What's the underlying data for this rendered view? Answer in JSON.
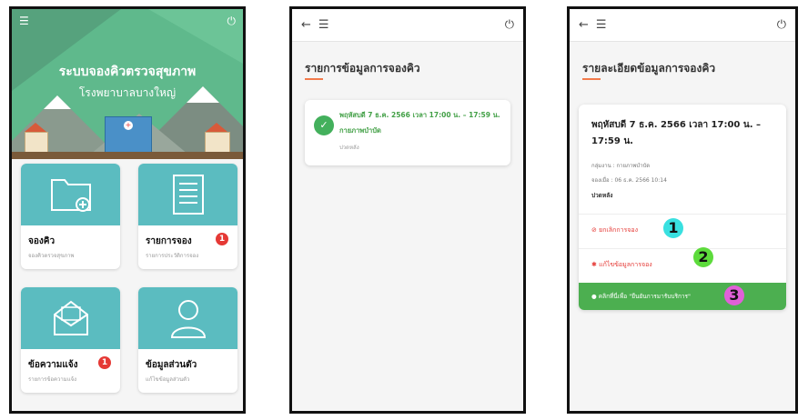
{
  "screen1": {
    "title": "ระบบจองคิวตรวจสุขภาพ",
    "subtitle": "โรงพยาบาลบางใหญ่",
    "tiles": [
      {
        "name": "จองคิว",
        "sub": "จองคิวตรวจสุขภาพ"
      },
      {
        "name": "รายการจอง",
        "sub": "รายการประวัติการจอง",
        "badge": "1"
      },
      {
        "name": "ข้อความแจ้ง",
        "sub": "รายการข้อความแจ้ง",
        "badge": "1"
      },
      {
        "name": "ข้อมูลส่วนตัว",
        "sub": "แก้ไขข้อมูลส่วนตัว"
      }
    ]
  },
  "screen2": {
    "title": "รายการข้อมูลการจองคิว",
    "item": {
      "line1": "พฤหัสบดี 7 ธ.ค. 2566 เวลา 17:00 น. – 17:59 น.",
      "line2": "กายภาพบำบัด",
      "line3": "ปวดหลัง"
    }
  },
  "screen3": {
    "title": "รายละเอียดข้อมูลการจองคิว",
    "datetime": "พฤหัสบดี 7 ธ.ค. 2566 เวลา 17:00 น. – 17:59 น.",
    "group": "กลุ่มงาน : กายภาพบำบัด",
    "booked_at": "จองเมื่อ : 06 ธ.ค. 2566 10:14",
    "symptom": "ปวดหลัง",
    "cancel_label": "⊘ ยกเลิกการจอง",
    "edit_label": "✱ แก้ไขข้อมูลการจอง",
    "confirm_label": "● คลิกที่นี่เพื่อ \"ยืนยันการมารับบริการ\"",
    "markers": [
      "1",
      "2",
      "3"
    ]
  },
  "colors": {
    "brand_green": "#5fb98c",
    "tile_teal": "#5bbcc0",
    "success_green": "#43a047",
    "confirm_green": "#4caf50",
    "danger_red": "#e53935",
    "accent_orange": "#f27a4b",
    "marker_cyan": "#39e0e0",
    "marker_green": "#5ddb3c",
    "marker_pink": "#e060d8"
  },
  "icons": {
    "menu": "menu-icon",
    "power": "power-icon",
    "back": "back-arrow-icon",
    "check": "check-circle-icon"
  }
}
